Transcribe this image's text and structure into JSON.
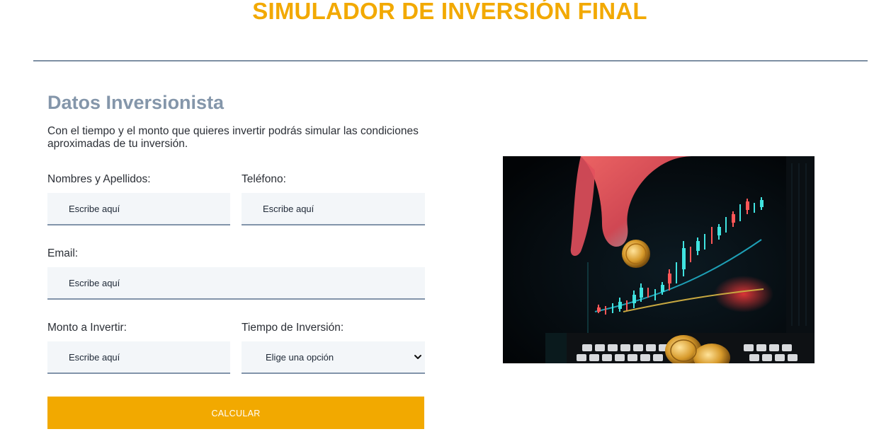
{
  "header": {
    "title": "SIMULADOR DE INVERSIÓN FINAL"
  },
  "form": {
    "section_title": "Datos Inversionista",
    "intro_line1": "Con el tiempo y el monto que quieres invertir podrás simular las condiciones",
    "intro_line2": "aproximadas de tu inversión.",
    "name_label": "Nombres y Apellidos:",
    "name_placeholder": "Escribe aquí",
    "phone_label": "Teléfono:",
    "phone_placeholder": "Escribe aquí",
    "email_label": "Email:",
    "email_placeholder": "Escribe aquí",
    "amount_label": "Monto a Invertir:",
    "amount_placeholder": "Escribe aquí",
    "term_label": "Tiempo de Inversión:",
    "term_selected": "Elige una opción",
    "submit_label": "CALCULAR"
  },
  "colors": {
    "accent": "#f2a900",
    "section_title": "#8496aa",
    "field_bg": "#f3f6f9",
    "field_border": "#8294aa"
  },
  "icons": {
    "select_chevron": "chevron-down-icon"
  }
}
